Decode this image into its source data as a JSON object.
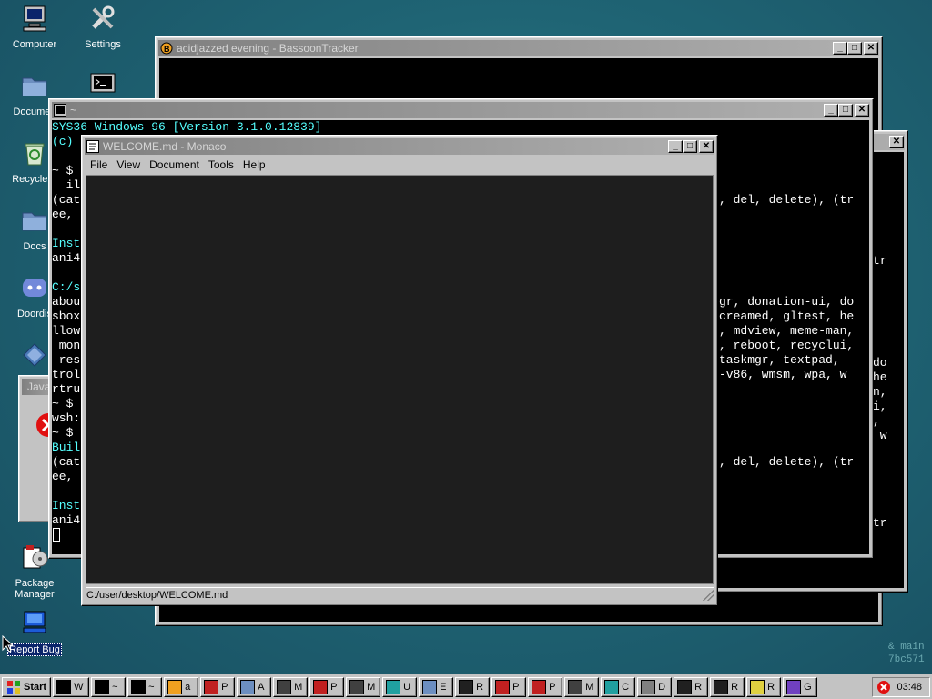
{
  "desktop": {
    "icons": [
      {
        "label": "Computer",
        "icon": "computer-icon"
      },
      {
        "label": "Settings",
        "icon": "settings-icon"
      },
      {
        "label": "Documen",
        "icon": "folder-icon"
      },
      {
        "label": "Recycle B",
        "icon": "recycle-bin-icon"
      },
      {
        "label": "Docs",
        "icon": "folder-icon"
      },
      {
        "label": "Doordis",
        "icon": "discord-icon"
      },
      {
        "label": "Package Manager",
        "icon": "package-manager-icon"
      },
      {
        "label": "Report Bug",
        "icon": "report-bug-icon"
      }
    ],
    "watermark": [
      "& main",
      "7bc571"
    ]
  },
  "bassoon": {
    "title": "acidjazzed evening - BassoonTracker"
  },
  "java_dialog": {
    "title": "Java"
  },
  "terminal": {
    "title": "~",
    "lines": [
      "SYS36 Windows 96 [Version 3.1.0.12839]",
      "(c)",
      "",
      "~ $",
      "  il",
      "(cat",
      "ee,",
      "",
      "Inst",
      "ani4",
      "",
      "C:/s",
      "abou",
      "sbox",
      "llow",
      " mon",
      " res",
      "trol",
      "rtru",
      "~ $",
      "wsh:",
      "~ $",
      "Buil",
      "(cat",
      "ee,",
      "",
      "Inst",
      "ani4"
    ],
    "right_lines": [
      {
        "row": 5,
        "text": ", del, delete), (tr"
      },
      {
        "row": 12,
        "text": "gr, donation-ui, do"
      },
      {
        "row": 13,
        "text": "creamed, gltest, he"
      },
      {
        "row": 14,
        "text": ", mdview, meme-man,"
      },
      {
        "row": 15,
        "text": ", reboot, recyclui,"
      },
      {
        "row": 16,
        "text": "taskmgr, textpad,"
      },
      {
        "row": 17,
        "text": "-v86, wmsm, wpa, w"
      },
      {
        "row": 23,
        "text": ", del, delete), (tr"
      }
    ]
  },
  "terminal2": {
    "title": "",
    "fragments": [
      {
        "row": 8,
        "text": "tr"
      },
      {
        "row": 15,
        "text": "do"
      },
      {
        "row": 16,
        "text": "he"
      },
      {
        "row": 17,
        "text": "n,"
      },
      {
        "row": 18,
        "text": "i,"
      },
      {
        "row": 19,
        "text": ","
      },
      {
        "row": 20,
        "text": " w"
      },
      {
        "row": 26,
        "text": "tr"
      }
    ]
  },
  "editor": {
    "title": "WELCOME.md - Monaco",
    "menu": [
      "File",
      "View",
      "Document",
      "Tools",
      "Help"
    ],
    "status_path": "C:/user/desktop/WELCOME.md"
  },
  "taskbar": {
    "start_label": "Start",
    "buttons": [
      {
        "label": "W",
        "icon": "terminal-icon"
      },
      {
        "label": "~",
        "icon": "terminal-icon"
      },
      {
        "label": "~",
        "icon": "terminal-icon"
      },
      {
        "label": "a",
        "icon": "bassoon-icon"
      },
      {
        "label": "P",
        "icon": "document-icon"
      },
      {
        "label": "A",
        "icon": "folder-icon"
      },
      {
        "label": "M",
        "icon": "monitor-icon"
      },
      {
        "label": "P",
        "icon": "document-icon"
      },
      {
        "label": "M",
        "icon": "monitor-icon"
      },
      {
        "label": "U",
        "icon": "app-icon"
      },
      {
        "label": "E",
        "icon": "folder-icon"
      },
      {
        "label": "R",
        "icon": "run-icon"
      },
      {
        "label": "P",
        "icon": "document-icon"
      },
      {
        "label": "P",
        "icon": "document-icon"
      },
      {
        "label": "M",
        "icon": "monitor-icon"
      },
      {
        "label": "C",
        "icon": "app-icon"
      },
      {
        "label": "D",
        "icon": "box-icon"
      },
      {
        "label": "R",
        "icon": "run-icon"
      },
      {
        "label": "R",
        "icon": "run-icon"
      },
      {
        "label": "R",
        "icon": "notepad-icon"
      },
      {
        "label": "G",
        "icon": "game-icon"
      }
    ],
    "clock": "03:48"
  }
}
